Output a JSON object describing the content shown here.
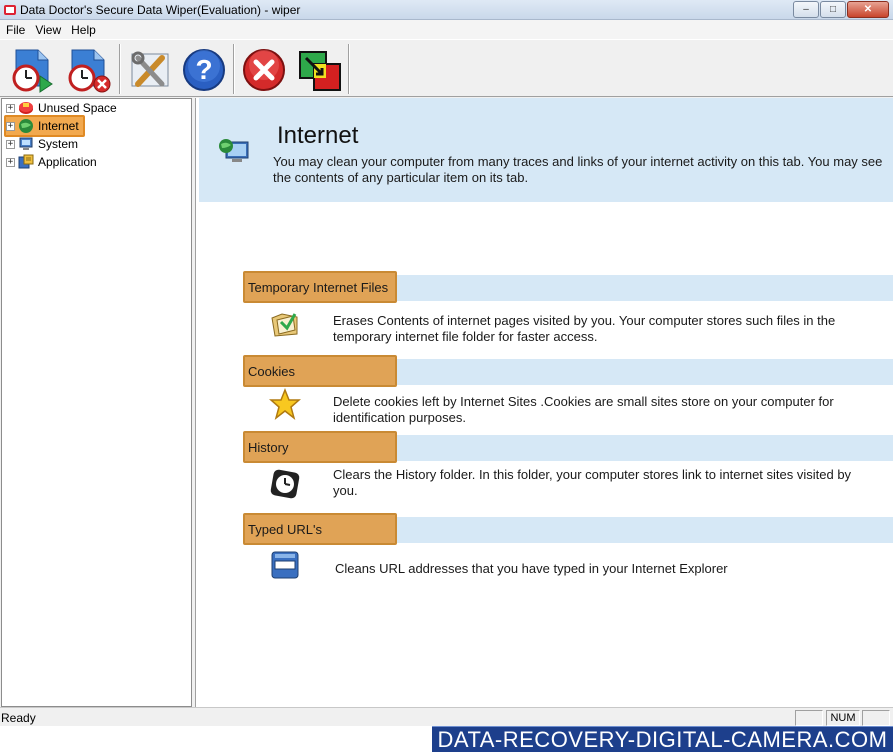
{
  "window": {
    "title": "Data Doctor's Secure Data Wiper(Evaluation) - wiper",
    "min_label": "–",
    "max_label": "□",
    "close_label": "✕"
  },
  "menu": {
    "file": "File",
    "view": "View",
    "help": "Help"
  },
  "toolbar": {
    "buttons": [
      {
        "icon": "schedule-start-icon"
      },
      {
        "icon": "schedule-stop-icon"
      },
      {
        "icon": "settings-tools-icon"
      },
      {
        "icon": "help-icon"
      },
      {
        "icon": "exit-icon"
      },
      {
        "icon": "about-icon"
      }
    ]
  },
  "tree": {
    "items": [
      {
        "label": "Unused Space",
        "expander": "+",
        "icon": "disk-icon"
      },
      {
        "label": "Internet",
        "expander": "+",
        "icon": "globe-icon",
        "selected": true
      },
      {
        "label": "System",
        "expander": "+",
        "icon": "computer-icon"
      },
      {
        "label": "Application",
        "expander": "+",
        "icon": "application-icon"
      }
    ]
  },
  "header": {
    "title": "Internet",
    "description": "You may clean your computer from many traces and links of your internet activity on this tab. You may see the contents of any particular item on its tab."
  },
  "sections": [
    {
      "title": "Temporary Internet Files",
      "icon": "folder-icon",
      "description": "Erases Contents of internet pages visited by you. Your computer stores such files in the temporary internet file folder for faster access."
    },
    {
      "title": "Cookies",
      "icon": "star-icon",
      "description": "Delete cookies left by Internet Sites .Cookies are small sites store on your computer for identification purposes."
    },
    {
      "title": "History",
      "icon": "clock-icon",
      "description": "Clears the History folder. In this folder, your computer stores link to internet sites visited by you."
    },
    {
      "title": "Typed URL's",
      "icon": "address-bar-icon",
      "description": "Cleans URL addresses that you have typed in your Internet Explorer"
    }
  ],
  "status": {
    "text": "Ready",
    "num": "NUM"
  },
  "watermark": "DATA-RECOVERY-DIGITAL-CAMERA.COM",
  "colors": {
    "section_tab": "#e0a356",
    "band": "#d6e8f6",
    "selection": "#f2a94f",
    "watermark_bg": "#1d3f8c"
  }
}
